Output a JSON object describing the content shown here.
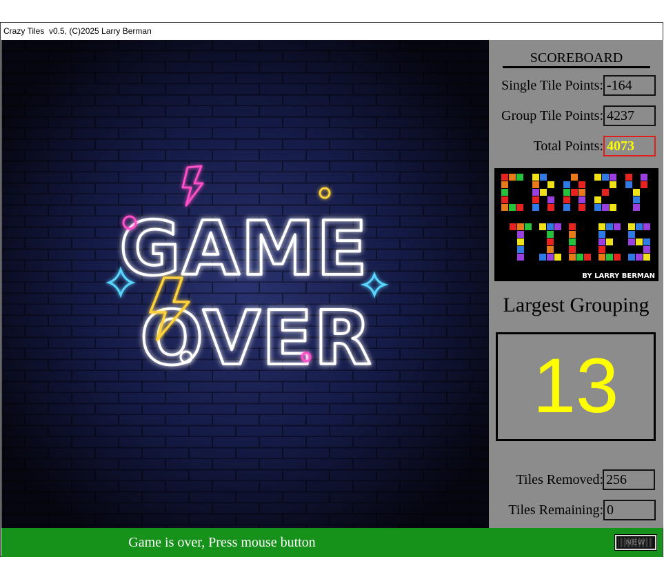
{
  "window": {
    "title": "Crazy Tiles  v0.5, (C)2025 Larry Berman"
  },
  "game": {
    "overlay_text_line1": "GAME",
    "overlay_text_line2": "OVER"
  },
  "scoreboard": {
    "title": "SCOREBOARD",
    "single_label": "Single Tile Points:",
    "single_value": "-164",
    "group_label": "Group Tile Points:",
    "group_value": "4237",
    "total_label": "Total Points:",
    "total_value": "4073",
    "logo_byline": "BY LARRY BERMAN",
    "largest_label": "Largest Grouping",
    "largest_value": "13",
    "removed_label": "Tiles Removed:",
    "removed_value": "256",
    "remaining_label": "Tiles Remaining:",
    "remaining_value": "0"
  },
  "status": {
    "message": "Game is over, Press mouse button",
    "button_label": "NEW"
  },
  "colors": {
    "scoreboard_bg": "#8c8c8c",
    "status_bg": "#16921a",
    "total_border": "#e21b1b",
    "highlight_yellow": "#ffff00"
  }
}
